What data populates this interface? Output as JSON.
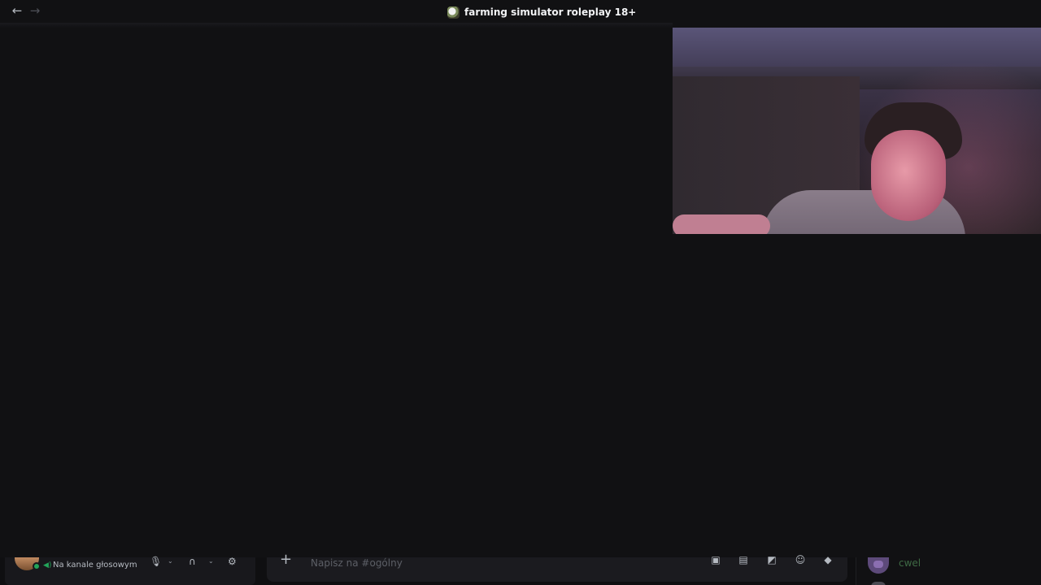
{
  "titlebar": {
    "back_icon": "arrow-left-icon",
    "forward_icon": "arrow-right-icon",
    "server_icon": "server-avatar-icon",
    "server_name": "farming simulator roleplay 18+"
  },
  "video": {
    "webcam_tile": "camera-feed"
  },
  "user_panel": {
    "voice_status": "Na kanale głosowym",
    "status_color": "#23a55a",
    "controls": [
      "microphone-icon",
      "chevron-down-icon",
      "headphones-icon",
      "chevron-down-icon",
      "gear-icon"
    ]
  },
  "composer": {
    "placeholder": "Napisz na #ogólny",
    "icons": [
      "gift-icon",
      "gif-icon",
      "sticker-icon",
      "emoji-icon",
      "apps-icon"
    ]
  },
  "members": {
    "name": "cwel",
    "name_color": "#3f6b45"
  },
  "colors": {
    "background": "#111113",
    "accent_online": "#23a55a"
  }
}
